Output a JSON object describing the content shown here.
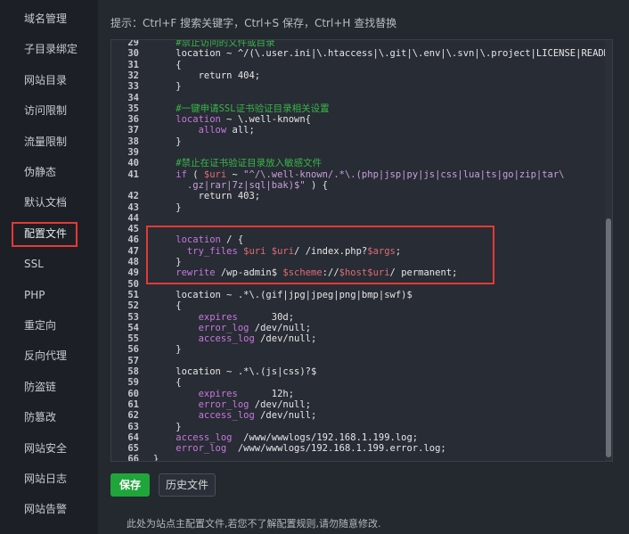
{
  "sidebar": {
    "items": [
      {
        "label": "域名管理"
      },
      {
        "label": "子目录绑定"
      },
      {
        "label": "网站目录"
      },
      {
        "label": "访问限制"
      },
      {
        "label": "流量限制"
      },
      {
        "label": "伪静态"
      },
      {
        "label": "默认文档"
      },
      {
        "label": "配置文件",
        "active": true
      },
      {
        "label": "SSL"
      },
      {
        "label": "PHP"
      },
      {
        "label": "重定向"
      },
      {
        "label": "反向代理"
      },
      {
        "label": "防盗链"
      },
      {
        "label": "防篡改"
      },
      {
        "label": "网站安全"
      },
      {
        "label": "网站日志"
      },
      {
        "label": "网站告警"
      }
    ]
  },
  "tip": "提示：Ctrl+F 搜索关键字，Ctrl+S 保存，Ctrl+H 查找替换",
  "editor": {
    "lines": [
      {
        "n": "29",
        "segs": [
          [
            "    #禁止访问的文件或目录",
            "#39b54a"
          ]
        ]
      },
      {
        "n": "30",
        "segs": [
          [
            "    location",
            "#e6e6e6"
          ],
          [
            " ~ ",
            "#e6e6e6"
          ],
          [
            "^/(\\.user.ini|\\.htaccess|\\.git|\\.env|\\.svn|\\.project|LICENSE|README.md)",
            "#e6e6e6"
          ]
        ]
      },
      {
        "n": "31",
        "segs": [
          [
            "    {",
            "#e6e6e6"
          ]
        ]
      },
      {
        "n": "32",
        "segs": [
          [
            "        return ",
            "#e6e6e6"
          ],
          [
            "404",
            "#e6e6e6"
          ],
          [
            ";",
            "#e6e6e6"
          ]
        ]
      },
      {
        "n": "33",
        "segs": [
          [
            "    }",
            "#e6e6e6"
          ]
        ]
      },
      {
        "n": "34",
        "segs": [
          [
            "",
            ""
          ]
        ]
      },
      {
        "n": "35",
        "segs": [
          [
            "    #一键申请SSL证书验证目录相关设置",
            "#39b54a"
          ]
        ]
      },
      {
        "n": "36",
        "segs": [
          [
            "    location",
            "#c678dd"
          ],
          [
            " ~ ",
            "#e6e6e6"
          ],
          [
            "\\.well-known{",
            "#e6e6e6"
          ]
        ]
      },
      {
        "n": "37",
        "segs": [
          [
            "        allow ",
            "#c678dd"
          ],
          [
            "all;",
            "#e6e6e6"
          ]
        ]
      },
      {
        "n": "38",
        "segs": [
          [
            "    }",
            "#e6e6e6"
          ]
        ]
      },
      {
        "n": "39",
        "segs": [
          [
            "",
            ""
          ]
        ]
      },
      {
        "n": "40",
        "segs": [
          [
            "    #禁止在证书验证目录放入敏感文件",
            "#39b54a"
          ]
        ]
      },
      {
        "n": "41",
        "segs": [
          [
            "    if",
            "#c678dd"
          ],
          [
            " ( ",
            "#e6e6e6"
          ],
          [
            "$uri",
            "#e06c75"
          ],
          [
            " ~ ",
            "#e6e6e6"
          ],
          [
            "\"^/\\.well-known/.*\\.(php|jsp|py|js|css|lua|ts|go|zip|tar\\",
            "#c9a0dc"
          ]
        ]
      },
      {
        "n": "",
        "segs": [
          [
            "      .gz|rar|7z|sql|bak)$\"",
            "#c9a0dc"
          ],
          [
            " ) {",
            "#e6e6e6"
          ]
        ]
      },
      {
        "n": "42",
        "segs": [
          [
            "        return ",
            "#e6e6e6"
          ],
          [
            "403",
            "#e6e6e6"
          ],
          [
            ";",
            "#e6e6e6"
          ]
        ]
      },
      {
        "n": "43",
        "segs": [
          [
            "    }",
            "#e6e6e6"
          ]
        ]
      },
      {
        "n": "44",
        "segs": [
          [
            "",
            ""
          ]
        ]
      },
      {
        "n": "45",
        "segs": [
          [
            "",
            ""
          ]
        ]
      },
      {
        "n": "46",
        "segs": [
          [
            "    location",
            "#c678dd"
          ],
          [
            " / {",
            "#e6e6e6"
          ]
        ]
      },
      {
        "n": "47",
        "segs": [
          [
            "      try_files ",
            "#c678dd"
          ],
          [
            "$uri $uri",
            "#e06c75"
          ],
          [
            "/ /index.php?",
            "#e6e6e6"
          ],
          [
            "$args",
            "#e06c75"
          ],
          [
            ";",
            "#e6e6e6"
          ]
        ]
      },
      {
        "n": "48",
        "segs": [
          [
            "    }",
            "#e6e6e6"
          ]
        ]
      },
      {
        "n": "49",
        "segs": [
          [
            "    rewrite ",
            "#c678dd"
          ],
          [
            "/wp-admin$ ",
            "#e6e6e6"
          ],
          [
            "$scheme",
            "#e06c75"
          ],
          [
            "://",
            "#e6e6e6"
          ],
          [
            "$host$uri",
            "#e06c75"
          ],
          [
            "/ permanent;",
            "#e6e6e6"
          ]
        ]
      },
      {
        "n": "50",
        "segs": [
          [
            "",
            ""
          ]
        ]
      },
      {
        "n": "51",
        "segs": [
          [
            "    location",
            "#e6e6e6"
          ],
          [
            " ~ ",
            "#e6e6e6"
          ],
          [
            ".*\\.(gif|jpg|jpeg|png|bmp|swf)$",
            "#e6e6e6"
          ]
        ]
      },
      {
        "n": "52",
        "segs": [
          [
            "    {",
            "#e6e6e6"
          ]
        ]
      },
      {
        "n": "53",
        "segs": [
          [
            "        expires",
            "#c678dd"
          ],
          [
            "      30d;",
            "#e6e6e6"
          ]
        ]
      },
      {
        "n": "54",
        "segs": [
          [
            "        error_log ",
            "#c678dd"
          ],
          [
            "/dev/null;",
            "#e6e6e6"
          ]
        ]
      },
      {
        "n": "55",
        "segs": [
          [
            "        access_log ",
            "#c678dd"
          ],
          [
            "/dev/null;",
            "#e6e6e6"
          ]
        ]
      },
      {
        "n": "56",
        "segs": [
          [
            "    }",
            "#e6e6e6"
          ]
        ]
      },
      {
        "n": "57",
        "segs": [
          [
            "",
            ""
          ]
        ]
      },
      {
        "n": "58",
        "segs": [
          [
            "    location",
            "#e6e6e6"
          ],
          [
            " ~ ",
            "#e6e6e6"
          ],
          [
            ".*\\.(js|css)?$",
            "#e6e6e6"
          ]
        ]
      },
      {
        "n": "59",
        "segs": [
          [
            "    {",
            "#e6e6e6"
          ]
        ]
      },
      {
        "n": "60",
        "segs": [
          [
            "        expires",
            "#c678dd"
          ],
          [
            "      12h;",
            "#e6e6e6"
          ]
        ]
      },
      {
        "n": "61",
        "segs": [
          [
            "        error_log ",
            "#c678dd"
          ],
          [
            "/dev/null;",
            "#e6e6e6"
          ]
        ]
      },
      {
        "n": "62",
        "segs": [
          [
            "        access_log ",
            "#c678dd"
          ],
          [
            "/dev/null;",
            "#e6e6e6"
          ]
        ]
      },
      {
        "n": "63",
        "segs": [
          [
            "    }",
            "#e6e6e6"
          ]
        ]
      },
      {
        "n": "64",
        "segs": [
          [
            "    access_log ",
            "#c678dd"
          ],
          [
            " /www/wwwlogs/192.168.1.199.log;",
            "#e6e6e6"
          ]
        ]
      },
      {
        "n": "65",
        "segs": [
          [
            "    error_log ",
            "#c678dd"
          ],
          [
            " /www/wwwlogs/192.168.1.199.error.log;",
            "#e6e6e6"
          ]
        ]
      },
      {
        "n": "66",
        "segs": [
          [
            "}",
            "#e6e6e6"
          ]
        ]
      }
    ]
  },
  "buttons": {
    "save": "保存",
    "history": "历史文件"
  },
  "note": "此处为站点主配置文件,若您不了解配置规则,请勿随意修改.",
  "colors": {
    "accent": "#20a53a",
    "highlight": "#e53935",
    "comment": "#39b54a",
    "keyword": "#c678dd",
    "variable": "#e06c75"
  }
}
